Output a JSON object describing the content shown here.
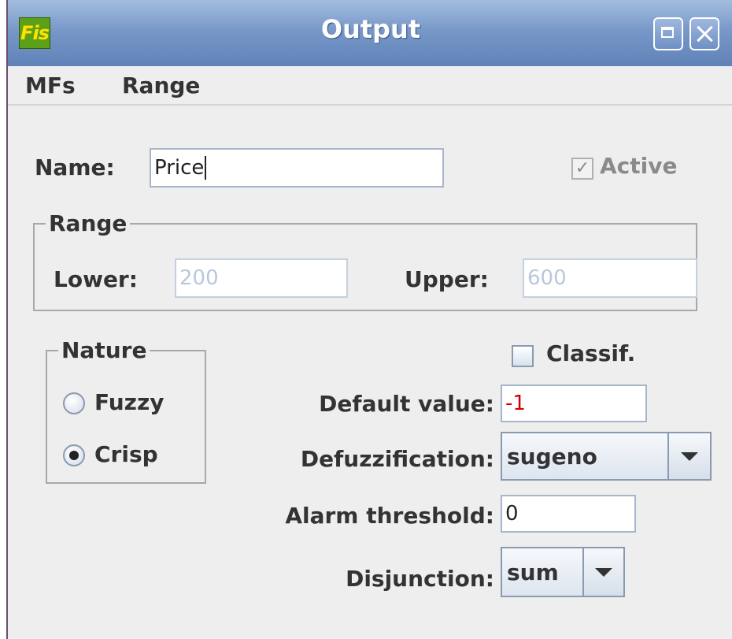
{
  "window": {
    "title": "Output",
    "app_icon_text": "Fis"
  },
  "menu": {
    "items": [
      "MFs",
      "Range"
    ]
  },
  "name_field": {
    "label": "Name:",
    "value": "Price"
  },
  "active": {
    "label": "Active",
    "checked": true,
    "enabled": false
  },
  "range_group": {
    "title": "Range",
    "lower_label": "Lower:",
    "lower_value": "200",
    "upper_label": "Upper:",
    "upper_value": "600"
  },
  "nature_group": {
    "title": "Nature",
    "options": [
      {
        "label": "Fuzzy",
        "selected": false
      },
      {
        "label": "Crisp",
        "selected": true
      }
    ]
  },
  "classif": {
    "label": "Classif.",
    "checked": false
  },
  "default_value": {
    "label": "Default value:",
    "value": "-1",
    "color": "#d00000"
  },
  "defuzzification": {
    "label": "Defuzzification:",
    "selected": "sugeno"
  },
  "alarm_threshold": {
    "label": "Alarm threshold:",
    "value": "0"
  },
  "disjunction": {
    "label": "Disjunction:",
    "selected": "sum"
  },
  "colors": {
    "titlebar": "#7898c8",
    "background": "#eeeeee",
    "app_icon": "#5ca017"
  },
  "icons": {
    "maximize": "maximize-icon",
    "close": "close-icon",
    "dropdown": "chevron-down-icon"
  }
}
